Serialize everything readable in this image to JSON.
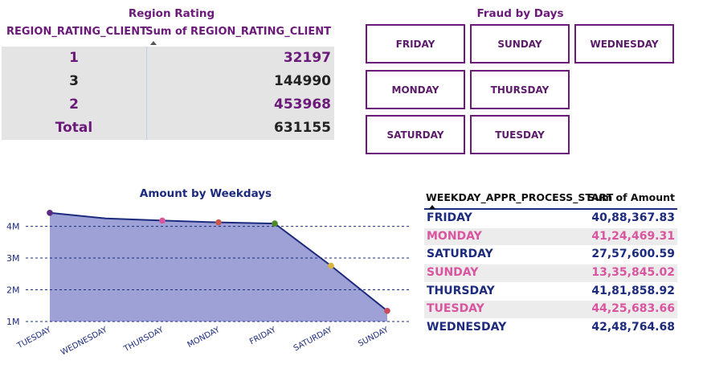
{
  "region_rating": {
    "title": "Region Rating",
    "col1_header": "REGION_RATING_CLIENT",
    "col2_header": "Sum of REGION_RATING_CLIENT",
    "rows": [
      {
        "rating": "1",
        "sum": "32197"
      },
      {
        "rating": "3",
        "sum": "144990"
      },
      {
        "rating": "2",
        "sum": "453968"
      }
    ],
    "total_label": "Total",
    "total_value": "631155"
  },
  "fraud_by_days": {
    "title": "Fraud by Days",
    "buttons": [
      "FRIDAY",
      "SUNDAY",
      "WEDNESDAY",
      "MONDAY",
      "THURSDAY",
      "SATURDAY",
      "TUESDAY"
    ]
  },
  "amount_chart": {
    "title": "Amount by Weekdays"
  },
  "chart_data": {
    "type": "area",
    "title": "Amount by Weekdays",
    "xlabel": "",
    "ylabel": "",
    "categories": [
      "TUESDAY",
      "WEDNESDAY",
      "THURSDAY",
      "MONDAY",
      "FRIDAY",
      "SATURDAY",
      "SUNDAY"
    ],
    "values": [
      4425683.66,
      4248764.68,
      4181858.92,
      4124469.31,
      4088367.83,
      2757600.59,
      1335845.02
    ],
    "marker_colors": [
      "#5b2a82",
      null,
      "#d9559f",
      "#c9574e",
      "#4d8a2a",
      "#d8b43a",
      "#c94a5a"
    ],
    "yticks": [
      {
        "value": 1000000,
        "label": "1M"
      },
      {
        "value": 2000000,
        "label": "2M"
      },
      {
        "value": 3000000,
        "label": "3M"
      },
      {
        "value": 4000000,
        "label": "4M"
      }
    ],
    "ylim": [
      1000000,
      4800000
    ],
    "grid": true,
    "fill_color": "#9da1d6",
    "line_color": "#1c2b7d"
  },
  "amount_table": {
    "col1_header": "WEEKDAY_APPR_PROCESS_START",
    "col2_header": "Sum of Amount",
    "rows": [
      {
        "day": "FRIDAY",
        "amount": "40,88,367.83",
        "style": "navy"
      },
      {
        "day": "MONDAY",
        "amount": "41,24,469.31",
        "style": "pink"
      },
      {
        "day": "SATURDAY",
        "amount": "27,57,600.59",
        "style": "navy"
      },
      {
        "day": "SUNDAY",
        "amount": "13,35,845.02",
        "style": "pink"
      },
      {
        "day": "THURSDAY",
        "amount": "41,81,858.92",
        "style": "navy"
      },
      {
        "day": "TUESDAY",
        "amount": "44,25,683.66",
        "style": "pink"
      },
      {
        "day": "WEDNESDAY",
        "amount": "42,48,764.68",
        "style": "navy"
      }
    ]
  }
}
